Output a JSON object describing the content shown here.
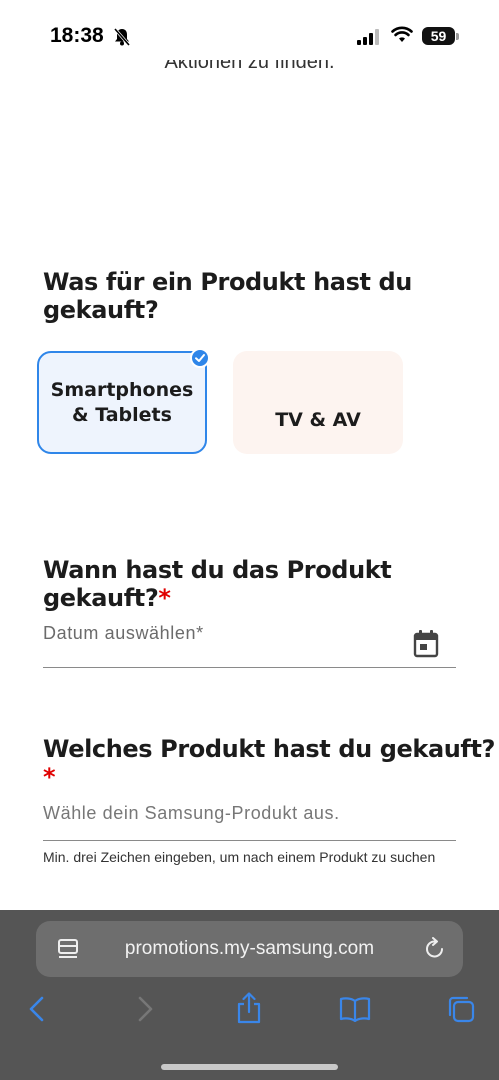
{
  "status_bar": {
    "time": "18:38",
    "battery": "59"
  },
  "cutoff_text": "Aktionen zu finden.",
  "product_type": {
    "question": "Was für ein Produkt hast du gekauft?",
    "options": [
      {
        "label": "Smartphones\n& Tablets",
        "selected": true
      },
      {
        "label": "TV & AV",
        "selected": false
      }
    ]
  },
  "purchase_date": {
    "question": "Wann hast du das Produkt gekauft?",
    "required_mark": "*",
    "placeholder": "Datum auswählen*"
  },
  "product": {
    "question": "Welches Produkt hast du gekauft?",
    "required_mark": "*",
    "placeholder": "Wähle dein Samsung-Produkt aus.",
    "helper": "Min. drei Zeichen eingeben, um nach einem Produkt zu suchen"
  },
  "browser": {
    "url": "promotions.my-samsung.com",
    "accent_color": "#3a86e9"
  }
}
